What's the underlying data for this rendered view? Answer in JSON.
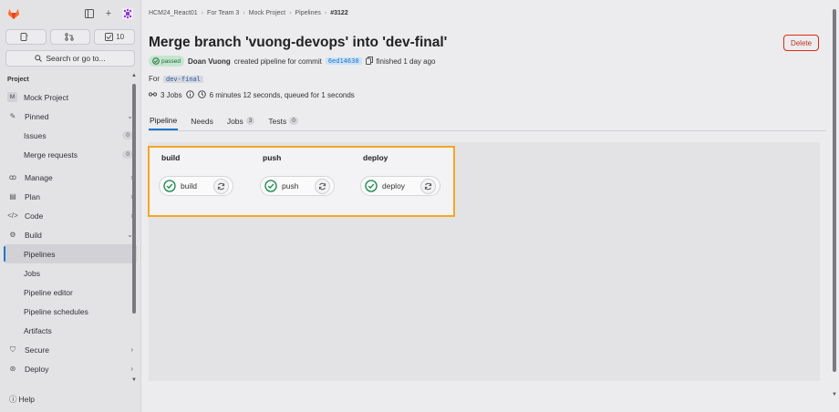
{
  "sidebar": {
    "todo_count": "",
    "mr_count": "",
    "issues_count": "10",
    "search_label": "Search or go to...",
    "section_label": "Project",
    "project": {
      "avatar": "M",
      "name": "Mock Project"
    },
    "pinned": {
      "label": "Pinned",
      "items": [
        {
          "label": "Issues",
          "count": "0"
        },
        {
          "label": "Merge requests",
          "count": "0"
        }
      ]
    },
    "nav": [
      {
        "label": "Manage"
      },
      {
        "label": "Plan"
      },
      {
        "label": "Code"
      },
      {
        "label": "Build"
      }
    ],
    "build_items": [
      {
        "label": "Pipelines"
      },
      {
        "label": "Jobs"
      },
      {
        "label": "Pipeline editor"
      },
      {
        "label": "Pipeline schedules"
      },
      {
        "label": "Artifacts"
      }
    ],
    "nav_after": [
      {
        "label": "Secure"
      },
      {
        "label": "Deploy"
      }
    ],
    "help_label": "Help"
  },
  "breadcrumb": [
    "HCM24_React01",
    "For Team 3",
    "Mock Project",
    "Pipelines",
    "#3122"
  ],
  "page": {
    "title": "Merge branch 'vuong-devops' into 'dev-final'",
    "delete_label": "Delete",
    "status": "passed",
    "author": "Doan Vuong",
    "created_text": "created pipeline for commit",
    "commit": "6ed14630",
    "finished_text": "finished 1 day ago",
    "for_label": "For",
    "ref": "dev-final",
    "jobs_text": "3 Jobs",
    "duration_text": "6 minutes 12 seconds, queued for 1 seconds"
  },
  "tabs": [
    {
      "label": "Pipeline",
      "count": ""
    },
    {
      "label": "Needs",
      "count": ""
    },
    {
      "label": "Jobs",
      "count": "3"
    },
    {
      "label": "Tests",
      "count": "0"
    }
  ],
  "stages": [
    {
      "name": "build",
      "job": "build"
    },
    {
      "name": "push",
      "job": "push"
    },
    {
      "name": "deploy",
      "job": "deploy"
    }
  ],
  "colors": {
    "accent": "#1f75cb",
    "success": "#108548",
    "danger": "#dd2b0e",
    "highlight": "#f5a623"
  }
}
